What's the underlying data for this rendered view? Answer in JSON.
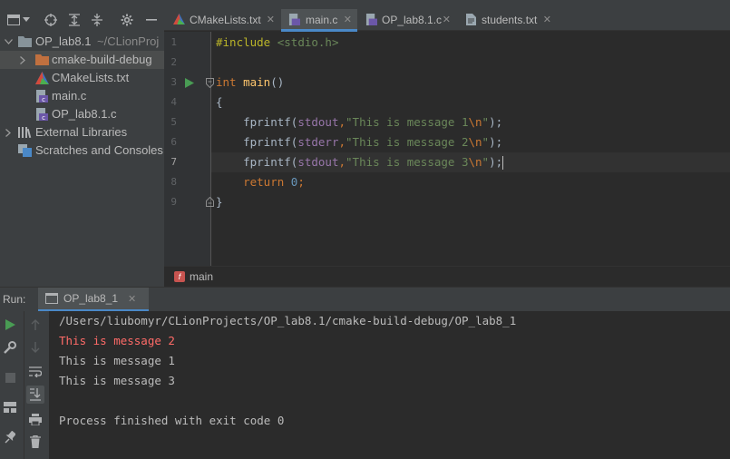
{
  "project_tree": {
    "items": [
      {
        "label": "OP_lab8.1",
        "detail": "~/CLionProj"
      },
      {
        "label": "cmake-build-debug"
      },
      {
        "label": "CMakeLists.txt"
      },
      {
        "label": "main.c"
      },
      {
        "label": "OP_lab8.1.c"
      },
      {
        "label": "External Libraries"
      },
      {
        "label": "Scratches and Consoles"
      }
    ]
  },
  "editor": {
    "tabs": [
      {
        "label": "CMakeLists.txt",
        "active": false
      },
      {
        "label": "main.c",
        "active": true
      },
      {
        "label": "OP_lab8.1.c",
        "active": false
      },
      {
        "label": "students.txt",
        "active": false
      }
    ],
    "line_numbers": [
      "1",
      "2",
      "3",
      "4",
      "5",
      "6",
      "7",
      "8",
      "9"
    ],
    "current_line": "7",
    "code": {
      "l1_directive": "#include",
      "l1_header": " <stdio.h>",
      "l3_kw": "int",
      "l3_fn": "main",
      "l3_paren": "()",
      "l4": "{",
      "fprintf": "fprintf(",
      "stdout": "stdout",
      "stderr": "stderr",
      "comma": ",",
      "l5_str": "\"This is message 1",
      "l6_str": "\"This is message 2",
      "l7_str": "\"This is message 3",
      "esc": "\\n",
      "quote": "\"",
      "close": ");",
      "l8_kw": "return",
      "l8_num": "0",
      "l8_semi": ";",
      "l9": "}"
    },
    "breadcrumb": "main",
    "breadcrumb_badge": "f"
  },
  "run": {
    "label": "Run:",
    "tab_label": "OP_lab8_1",
    "output": [
      {
        "text": "/Users/liubomyr/CLionProjects/OP_lab8.1/cmake-build-debug/OP_lab8_1",
        "stream": "stdout"
      },
      {
        "text": "This is message 2",
        "stream": "stderr"
      },
      {
        "text": "This is message 1",
        "stream": "stdout"
      },
      {
        "text": "This is message 3",
        "stream": "stdout"
      },
      {
        "text": "",
        "stream": "stdout"
      },
      {
        "text": "Process finished with exit code 0",
        "stream": "stdout"
      }
    ]
  },
  "colors": {
    "accent": "#4a88c7",
    "run_green": "#499c54",
    "error_red": "#ff6b68",
    "folder_orange": "#c0703f"
  }
}
